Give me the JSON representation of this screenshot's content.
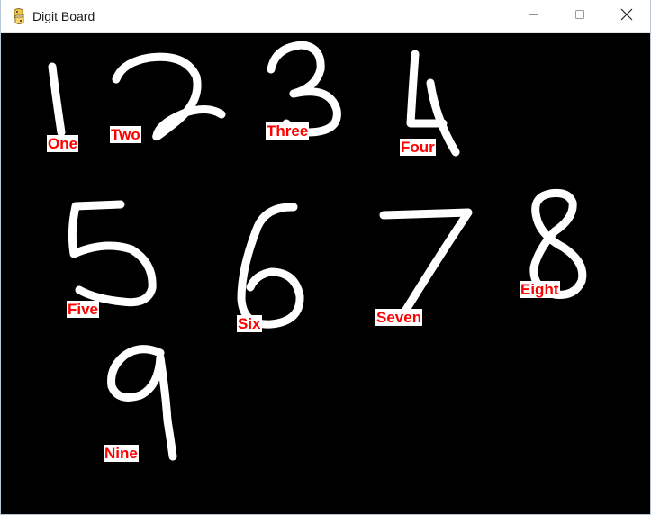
{
  "window": {
    "title": "Digit Board",
    "controls": [
      "minimize",
      "maximize",
      "close"
    ]
  },
  "icons": {
    "app": "python-icon",
    "minimize": "minimize-icon",
    "maximize": "maximize-icon",
    "close": "close-icon"
  },
  "colors": {
    "canvas_background": "#000000",
    "stroke": "#ffffff",
    "label_text": "#ff0000",
    "label_background": "#ffffff"
  },
  "digits": [
    {
      "digit": "1",
      "label": "One"
    },
    {
      "digit": "2",
      "label": "Two"
    },
    {
      "digit": "3",
      "label": "Three"
    },
    {
      "digit": "4",
      "label": "Four"
    },
    {
      "digit": "5",
      "label": "Five"
    },
    {
      "digit": "6",
      "label": "Six"
    },
    {
      "digit": "7",
      "label": "Seven"
    },
    {
      "digit": "8",
      "label": "Eight"
    },
    {
      "digit": "9",
      "label": "Nine"
    }
  ]
}
